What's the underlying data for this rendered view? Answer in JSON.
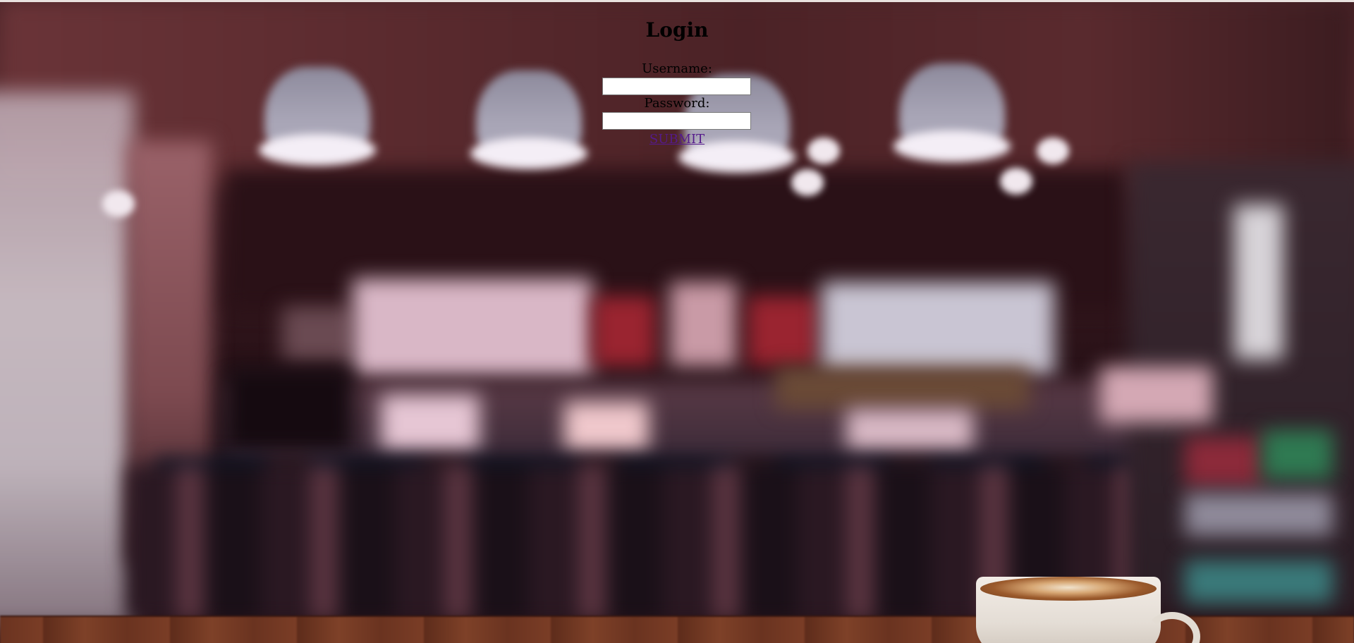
{
  "login": {
    "title": "Login",
    "username_label": "Username:",
    "username_value": "",
    "password_label": "Password:",
    "password_value": "",
    "submit_label": "SUBMIT"
  },
  "background": {
    "description_icon": "cafe-background-image",
    "link_color": "#551a8b",
    "title_color": "#000000"
  }
}
